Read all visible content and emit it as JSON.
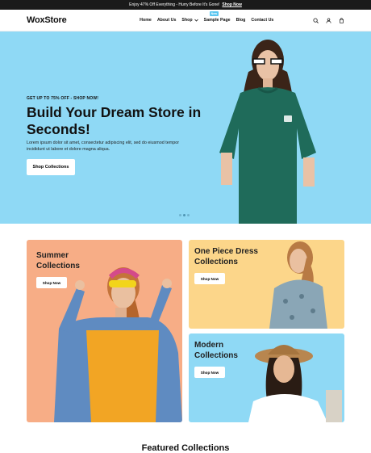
{
  "announcement": {
    "text": "Enjoy 47% Off Everything - Hurry Before It's Gone!",
    "link": "Shop Now"
  },
  "header": {
    "logo": "WoxStore",
    "nav": [
      {
        "label": "Home"
      },
      {
        "label": "About Us"
      },
      {
        "label": "Shop",
        "has_dropdown": true
      },
      {
        "label": "Sample Page",
        "badge": "New"
      },
      {
        "label": "Blog"
      },
      {
        "label": "Contact Us"
      }
    ],
    "icons": [
      "search-icon",
      "user-icon",
      "cart-icon"
    ]
  },
  "hero": {
    "kicker": "GET UP TO 75% OFF - SHOP NOW!",
    "title": "Build Your Dream Store in Seconds!",
    "description": "Lorem ipsum dolor sit amet, consectetur adipiscing elit, sed do eiusmod tempor incididunt ut labore et dolore magna aliqua.",
    "button": "Shop Collections",
    "background": "#8fd9f5",
    "slides": 3,
    "active_slide": 1
  },
  "collections": [
    {
      "title": "Summer Collections",
      "button": "Shop Now",
      "background": "#f7ad86"
    },
    {
      "title": "One Piece Dress Collections",
      "button": "Shop Now",
      "background": "#fcd68a"
    },
    {
      "title": "Modern Collections",
      "button": "Shop Now",
      "background": "#8fd9f5"
    }
  ],
  "featured": {
    "title": "Featured Collections"
  }
}
